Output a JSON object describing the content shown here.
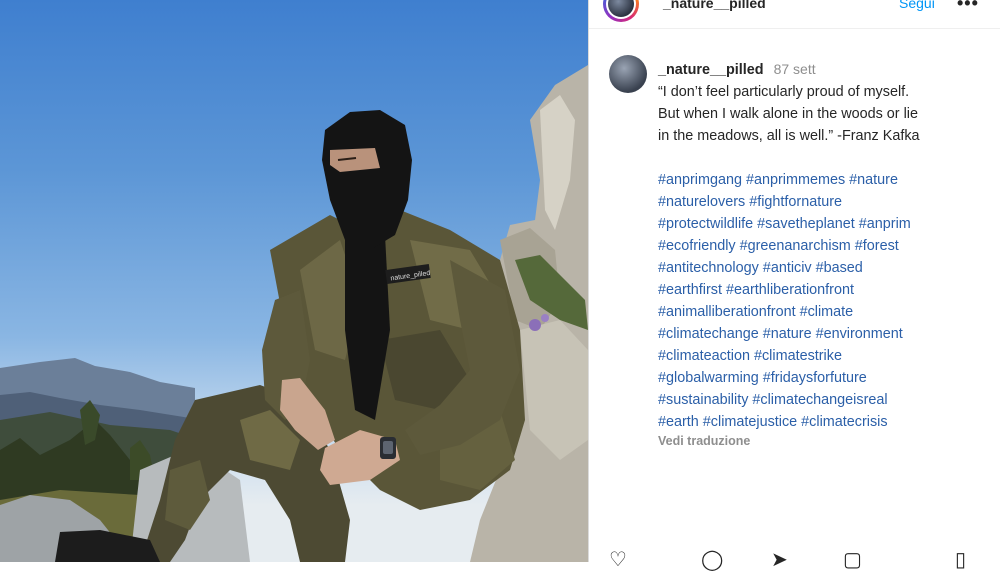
{
  "post": {
    "username": "_nature__pilled",
    "follow_label": "Segui",
    "more_label": "•••",
    "patch_text": "nature_pilled"
  },
  "caption": {
    "username": "_nature__pilled",
    "time": "87 sett",
    "quote_line1": "“I don’t feel particularly proud of myself.",
    "quote_line2": "But when I walk alone in the woods or lie",
    "quote_line3": "in the meadows, all is well.” -Franz Kafka",
    "hashtag_lines": [
      " #anprimgang #anprimmemes #nature",
      "#naturelovers #fightfornature",
      "#protectwildlife #savetheplanet #anprim",
      "#ecofriendly #greenanarchism #forest",
      "#antitechnology #anticiv #based",
      "#earthfirst #earthliberationfront",
      "#animalliberationfront #climate",
      "#climatechange #nature #environment",
      "#climateaction #climatestrike",
      "#globalwarming #fridaysforfuture",
      "#sustainability #climatechangeisreal",
      "#earth #climatejustice #climatecrisis"
    ],
    "translate_label": "Vedi traduzione"
  },
  "actions": {
    "like_icon": "heart-icon",
    "comment_icon": "comment-icon",
    "share_icon": "share-icon",
    "save_icon": "bookmark-icon"
  }
}
